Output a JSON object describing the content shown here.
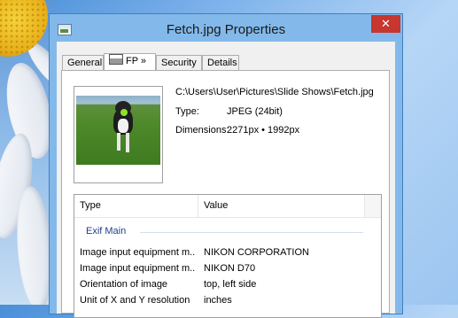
{
  "window": {
    "title": "Fetch.jpg Properties",
    "close_label": "✕"
  },
  "tabs": [
    {
      "label": "General"
    },
    {
      "label": "FP »"
    },
    {
      "label": "Security"
    },
    {
      "label": "Details"
    }
  ],
  "file": {
    "path": "C:\\Users\\User\\Pictures\\Slide Shows\\Fetch.jpg",
    "type_label": "Type:",
    "type_value": "JPEG (24bit)",
    "dimensions_label": "Dimensions:",
    "dimensions_value": "2271px • 1992px"
  },
  "list": {
    "columns": [
      "Type",
      "Value"
    ],
    "group": "Exif Main",
    "rows": [
      [
        "Image input equipment m...",
        "NIKON CORPORATION"
      ],
      [
        "Image input equipment m...",
        "NIKON D70"
      ],
      [
        "Orientation of image",
        "top, left side"
      ],
      [
        "Unit of X and Y resolution",
        "inches"
      ]
    ]
  },
  "icons": {
    "app": "picture-icon",
    "tab_fp": "fp-icon",
    "close": "close-icon"
  },
  "colors": {
    "close_button": "#c7362f",
    "window_frame": "#83b9ea",
    "group_header": "#1e3f8a"
  }
}
